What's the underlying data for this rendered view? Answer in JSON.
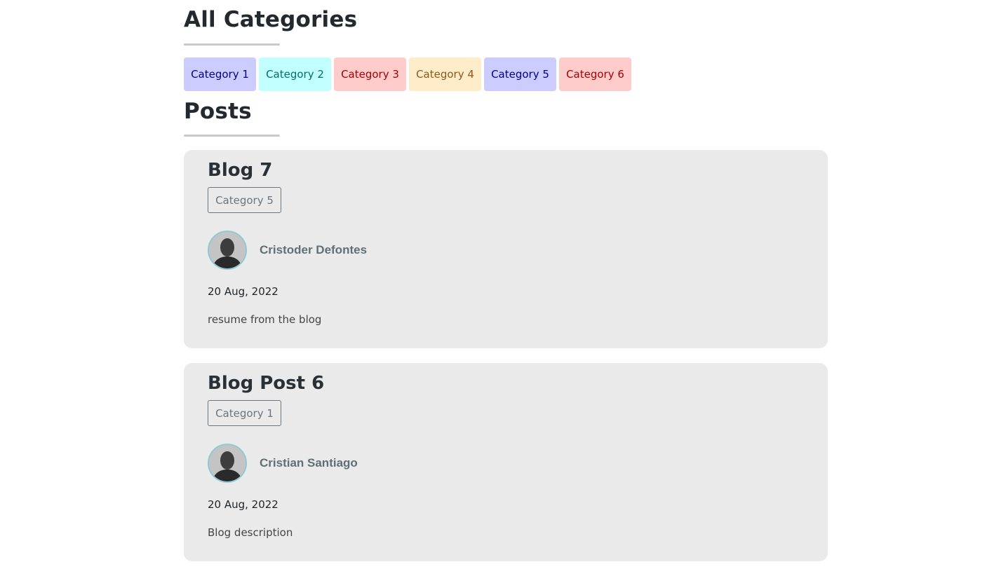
{
  "categories_section": {
    "title": "All Categories",
    "items": [
      {
        "label": "Category 1",
        "bg": "#ccccff",
        "fg": "#00008b"
      },
      {
        "label": "Category 2",
        "bg": "#c2ffff",
        "fg": "#006e6e"
      },
      {
        "label": "Category 3",
        "bg": "#ffcccc",
        "fg": "#a80000"
      },
      {
        "label": "Category 4",
        "bg": "#ffecc8",
        "fg": "#8a5a1a"
      },
      {
        "label": "Category 5",
        "bg": "#ccccff",
        "fg": "#00008b"
      },
      {
        "label": "Category 6",
        "bg": "#ffcccc",
        "fg": "#a80000"
      }
    ]
  },
  "posts_section": {
    "title": "Posts",
    "posts": [
      {
        "title": "Blog 7",
        "category": "Category 5",
        "author": "Cristoder Defontes",
        "date": "20 Aug, 2022",
        "description": "resume from the blog"
      },
      {
        "title": "Blog Post 6",
        "category": "Category 1",
        "author": "Cristian Santiago",
        "date": "20 Aug, 2022",
        "description": "Blog description"
      }
    ]
  },
  "colors": {
    "card_bg": "#eaeaea",
    "underline": "#c9c9c9",
    "avatar_border": "#8ecbd6"
  }
}
